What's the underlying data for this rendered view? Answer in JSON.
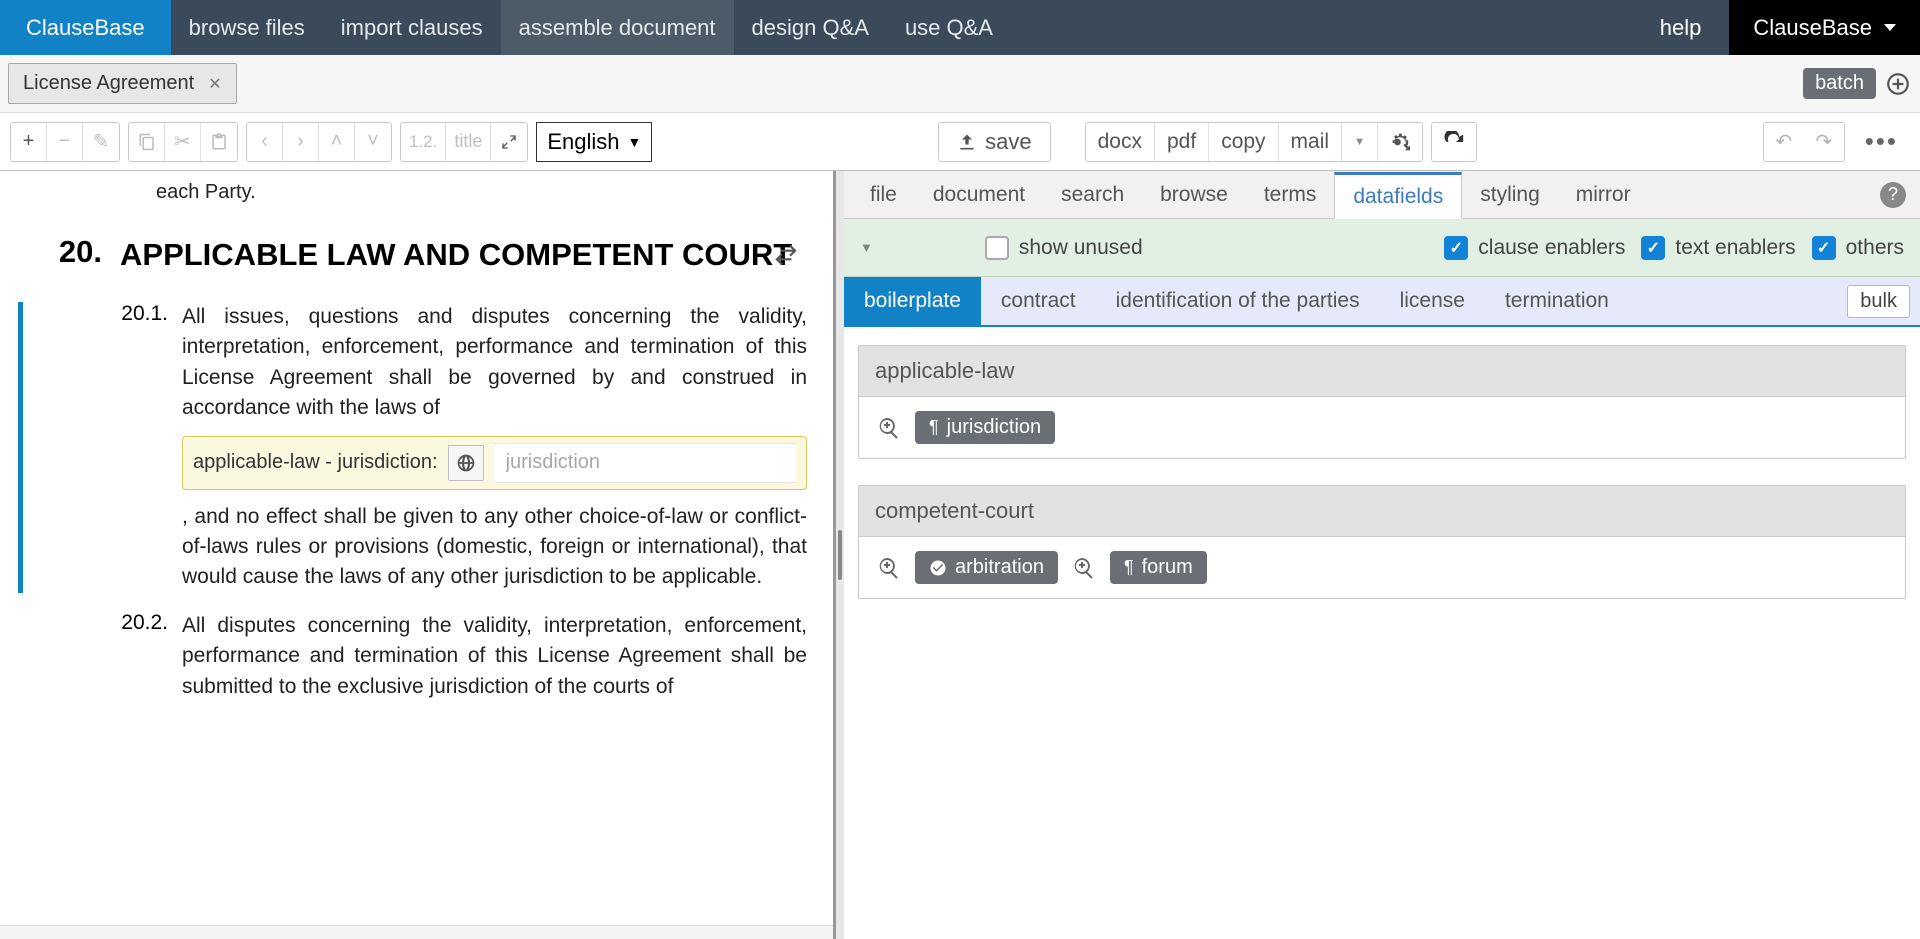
{
  "topnav": {
    "logo": "ClauseBase",
    "items": [
      "browse files",
      "import clauses",
      "assemble document",
      "design Q&A",
      "use Q&A"
    ],
    "active_index": 2,
    "help": "help",
    "brand": "ClauseBase"
  },
  "doc_tab": {
    "title": "License Agreement"
  },
  "batch_label": "batch",
  "toolbar": {
    "num_label": "1.2.",
    "title_label": "title",
    "language": "English",
    "save": "save",
    "exports": [
      "docx",
      "pdf",
      "copy",
      "mail"
    ]
  },
  "right_tabs": {
    "items": [
      "file",
      "document",
      "search",
      "browse",
      "terms",
      "datafields",
      "styling",
      "mirror"
    ],
    "active_index": 5
  },
  "filters": {
    "show_unused": "show unused",
    "clause_enablers": "clause enablers",
    "text_enablers": "text enablers",
    "others": "others"
  },
  "cat_tabs": {
    "items": [
      "boilerplate",
      "contract",
      "identification of the parties",
      "license",
      "termination"
    ],
    "active_index": 0,
    "bulk": "bulk"
  },
  "df_groups": [
    {
      "title": "applicable-law",
      "pills": [
        {
          "icon": "pilcrow",
          "label": "jurisdiction"
        }
      ]
    },
    {
      "title": "competent-court",
      "pills": [
        {
          "icon": "check",
          "label": "arbitration"
        },
        {
          "icon": "pilcrow",
          "label": "forum"
        }
      ]
    }
  ],
  "document": {
    "fragment_top": "each Party.",
    "section_num": "20.",
    "section_title": "APPLICABLE LAW AND COMPETENT COURT",
    "c1_num": "20.1.",
    "c1_text_a": "All issues, questions and disputes concerning the validity, interpretation, enforcement, performance and termination of this License Agreement shall be governed by and construed in accordance with the laws of",
    "c1_editor_label": "applicable-law - jurisdiction:",
    "c1_editor_placeholder": "jurisdiction",
    "c1_text_b": ", and no effect shall be given to any other choice-of-law or conflict-of-laws rules or provisions (domestic, foreign or international), that would cause the laws of any other jurisdiction to be applicable.",
    "c2_num": "20.2.",
    "c2_text": "All disputes concerning the validity, interpretation, enforcement, performance and termination of this License Agreement shall be submitted to the exclusive jurisdiction of the courts of"
  }
}
